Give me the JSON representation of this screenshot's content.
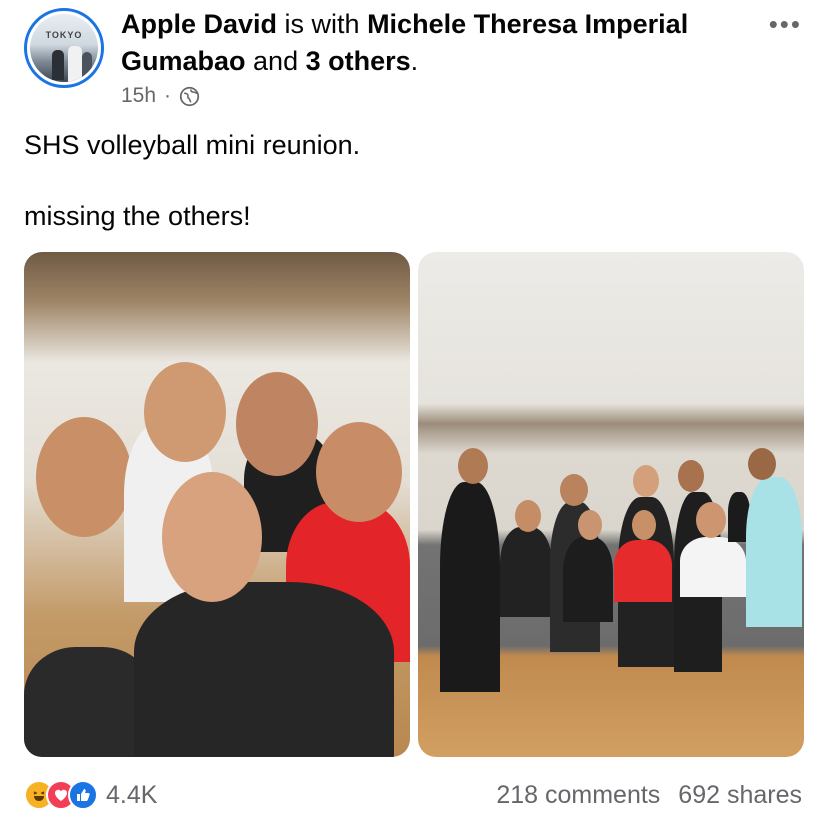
{
  "post": {
    "author": "Apple David",
    "with_text": " is with ",
    "tagged": "Michele Theresa Imperial Gumabao",
    "and_text": " and ",
    "others": "3 others",
    "period": ".",
    "time": "15h",
    "separator": "·",
    "audience_icon": "globe-icon",
    "avatar_sign": "TOKYO",
    "more_icon": "more-options-icon",
    "line1": "SHS volleyball mini reunion.",
    "line2": "missing the others!"
  },
  "reactions": {
    "icons": [
      "haha-icon",
      "love-icon",
      "like-icon"
    ],
    "count": "4.4K",
    "comments": "218 comments",
    "shares": "692 shares"
  },
  "colors": {
    "accent": "#1b74e4",
    "secondary_text": "#65676b",
    "love": "#f33e58",
    "haha": "#f7b125"
  }
}
